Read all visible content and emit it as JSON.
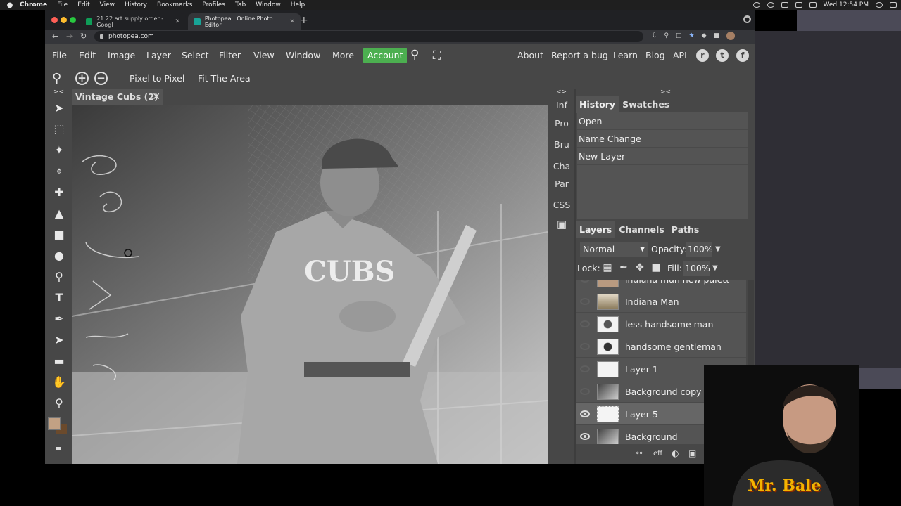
{
  "macbar": {
    "app": "Chrome",
    "menus": [
      "File",
      "Edit",
      "View",
      "History",
      "Bookmarks",
      "Profiles",
      "Tab",
      "Window",
      "Help"
    ],
    "clock": "Wed 12:54 PM"
  },
  "browser": {
    "tabs": [
      {
        "title": "21 22 art supply order - Googl",
        "favicon_color": "#0f9d58"
      },
      {
        "title": "Photopea | Online Photo Editor",
        "favicon_color": "#18a497"
      }
    ],
    "url": "photopea.com"
  },
  "menu": {
    "items": [
      "File",
      "Edit",
      "Image",
      "Layer",
      "Select",
      "Filter",
      "View",
      "Window",
      "More"
    ],
    "account": "Account",
    "links": [
      "About",
      "Report a bug",
      "Learn",
      "Blog",
      "API"
    ]
  },
  "options": {
    "pixel_to_pixel": "Pixel to Pixel",
    "fit_area": "Fit The Area"
  },
  "document": {
    "tab_title": "Vintage Cubs (2)",
    "jersey_text": "CUBS"
  },
  "side_icons": [
    "Inf",
    "Pro",
    "Bru",
    "Cha",
    "Par",
    "CSS"
  ],
  "history": {
    "tabs": [
      "History",
      "Swatches"
    ],
    "items": [
      "Open",
      "Name Change",
      "New Layer"
    ]
  },
  "layers_panel": {
    "tabs": [
      "Layers",
      "Channels",
      "Paths"
    ],
    "blend_mode": "Normal",
    "opacity_label": "Opacity:",
    "opacity": "100%",
    "lock_label": "Lock:",
    "fill_label": "Fill:",
    "fill": "100%",
    "layers": [
      {
        "name": "indiana man new palett",
        "visible": false,
        "selected": false
      },
      {
        "name": "Indiana Man",
        "visible": false,
        "selected": false
      },
      {
        "name": "less handsome man",
        "visible": false,
        "selected": false
      },
      {
        "name": "handsome gentleman",
        "visible": false,
        "selected": false
      },
      {
        "name": "Layer 1",
        "visible": false,
        "selected": false
      },
      {
        "name": "Background copy",
        "visible": false,
        "selected": false
      },
      {
        "name": "Layer 5",
        "visible": true,
        "selected": true
      },
      {
        "name": "Background",
        "visible": true,
        "selected": false
      }
    ],
    "footer_eff": "eff"
  },
  "webcam": {
    "label": "Mr. Bale"
  }
}
